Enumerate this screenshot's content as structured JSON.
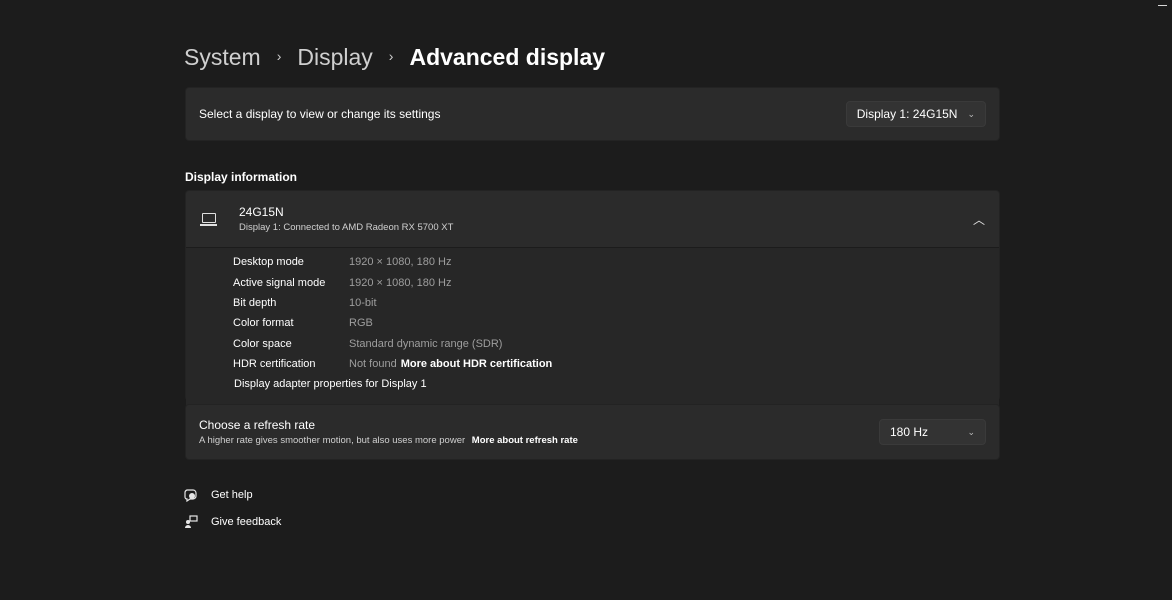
{
  "window": {
    "minimize_label": "Minimize"
  },
  "breadcrumb": {
    "items": [
      "System",
      "Display",
      "Advanced display"
    ],
    "separator": "›"
  },
  "display_select": {
    "label": "Select a display to view or change its settings",
    "selected": "Display 1: 24G15N"
  },
  "display_information": {
    "section_title": "Display information",
    "monitor_name": "24G15N",
    "connection": "Display 1: Connected to AMD Radeon RX 5700 XT",
    "expanded": true,
    "rows": [
      {
        "key": "Desktop mode",
        "value": "1920 × 1080, 180 Hz"
      },
      {
        "key": "Active signal mode",
        "value": "1920 × 1080, 180 Hz"
      },
      {
        "key": "Bit depth",
        "value": "10-bit"
      },
      {
        "key": "Color format",
        "value": "RGB"
      },
      {
        "key": "Color space",
        "value": "Standard dynamic range (SDR)"
      },
      {
        "key": "HDR certification",
        "value": "Not found",
        "link": "More about HDR certification"
      }
    ],
    "adapter_link": "Display adapter properties for Display 1"
  },
  "refresh_rate": {
    "title": "Choose a refresh rate",
    "description": "A higher rate gives smoother motion, but also uses more power",
    "link": "More about refresh rate",
    "selected": "180 Hz"
  },
  "footer": {
    "get_help": "Get help",
    "give_feedback": "Give feedback"
  },
  "icons": {
    "chevron_down": "⌄",
    "chevron_up": "⌃"
  }
}
